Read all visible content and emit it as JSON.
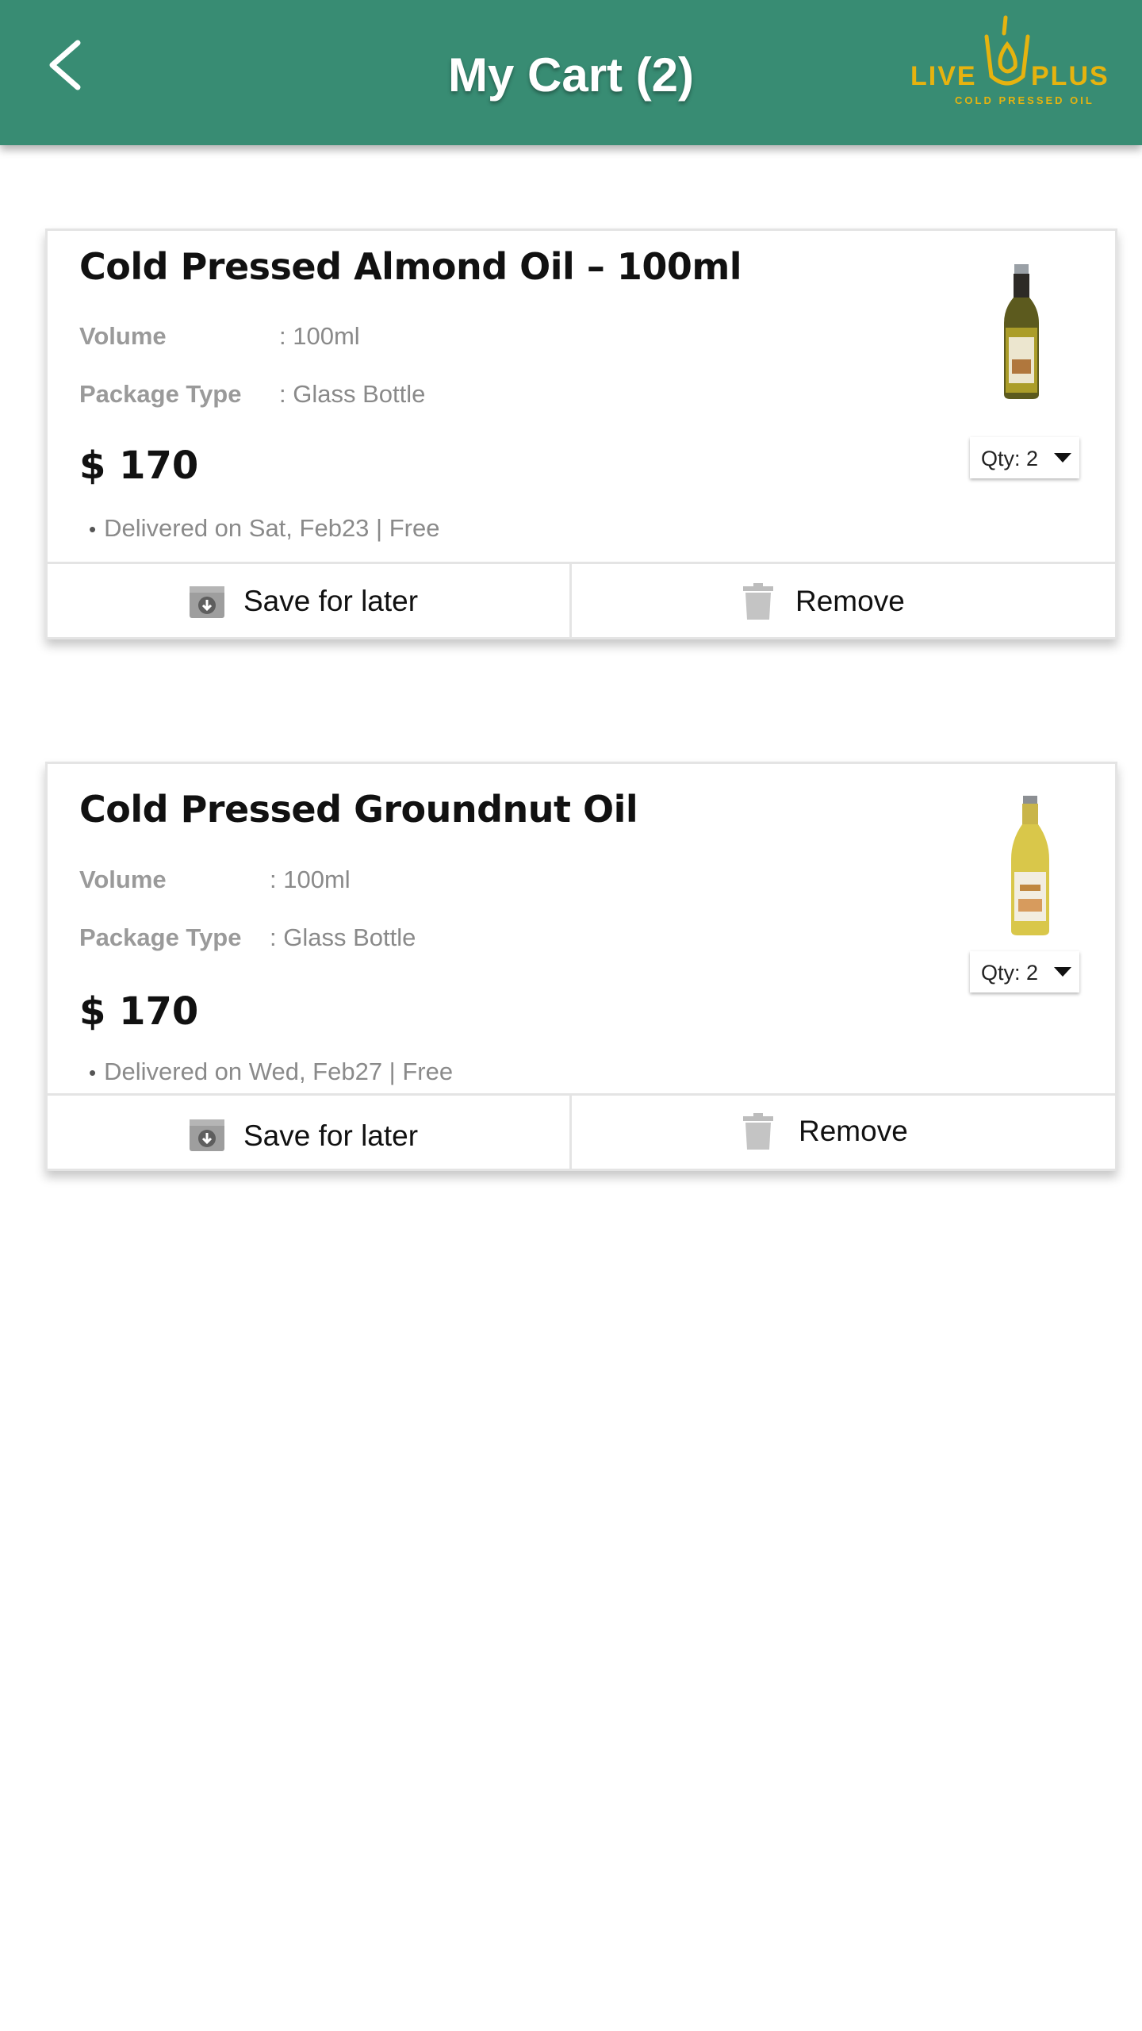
{
  "header": {
    "title": "My Cart (2)",
    "back_icon": "chevron-left-icon",
    "logo": {
      "word1": "LIVE",
      "word2": "PLUS",
      "tagline": "COLD PRESSED OIL"
    },
    "bg_color": "#388c73"
  },
  "cart": {
    "items": [
      {
        "name": "Cold Pressed Almond Oil – 100ml",
        "volume_label": "Volume",
        "volume_value": ": 100ml",
        "package_label": "Package Type",
        "package_value": ": Glass Bottle",
        "price": "$ 170",
        "delivery": "Delivered on Sat, Feb23 | Free",
        "qty": "Qty: 2",
        "save_label": "Save for later",
        "remove_label": "Remove"
      },
      {
        "name": "Cold Pressed Groundnut Oil",
        "volume_label": "Volume",
        "volume_value": ": 100ml",
        "package_label": "Package Type",
        "package_value": ": Glass Bottle",
        "price": "$ 170",
        "delivery": "Delivered on Wed, Feb27 | Free",
        "qty": "Qty: 2",
        "save_label": "Save for later",
        "remove_label": "Remove"
      }
    ]
  }
}
